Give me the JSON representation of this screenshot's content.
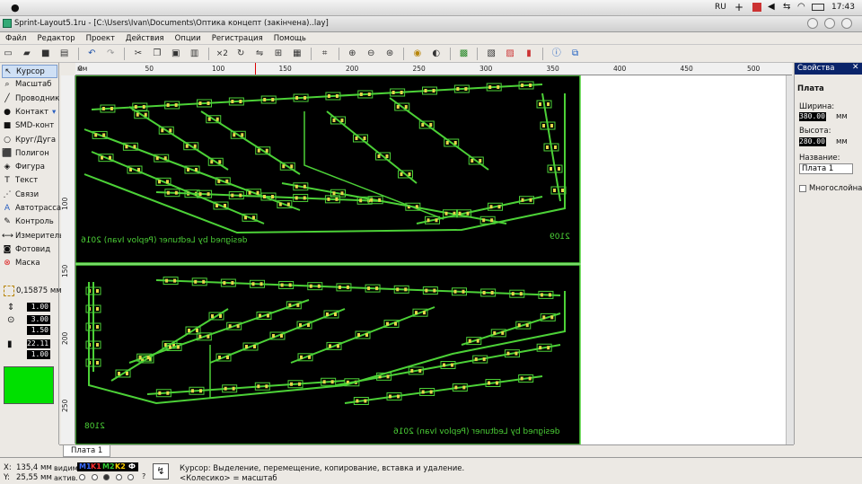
{
  "os_menubar": {
    "lang": "RU",
    "time": "17:43"
  },
  "window": {
    "title": "Sprint-Layout5.1ru - [C:\\Users\\Ivan\\Documents\\Оптика концепт (закінчена)..lay]"
  },
  "menu": [
    "Файл",
    "Редактор",
    "Проект",
    "Действия",
    "Опции",
    "Регистрация",
    "Помощь"
  ],
  "toolbar": {
    "zoom_label": "×2"
  },
  "tools": [
    {
      "name": "cursor",
      "label": "Курсор",
      "icon": "cursor-arrow-icon",
      "active": true
    },
    {
      "name": "zoom",
      "label": "Масштаб",
      "icon": "magnifier-icon"
    },
    {
      "name": "track",
      "label": "Проводник",
      "icon": "pen-icon"
    },
    {
      "name": "pad",
      "label": "Контакт",
      "icon": "pad-icon",
      "dropdown": true
    },
    {
      "name": "smd",
      "label": "SMD-конт",
      "icon": "smd-pad-icon"
    },
    {
      "name": "circle",
      "label": "Круг/Дуга",
      "icon": "circle-icon"
    },
    {
      "name": "polygon",
      "label": "Полигон",
      "icon": "polygon-icon"
    },
    {
      "name": "shape",
      "label": "Фигура",
      "icon": "shape-icon"
    },
    {
      "name": "text",
      "label": "Текст",
      "icon": "text-icon"
    },
    {
      "name": "connection",
      "label": "Связи",
      "icon": "connection-icon"
    },
    {
      "name": "autoroute",
      "label": "Автотрасса",
      "icon": "autoroute-icon"
    },
    {
      "name": "test",
      "label": "Контроль",
      "icon": "probe-icon"
    },
    {
      "name": "measure",
      "label": "Измеритель",
      "icon": "ruler-icon"
    },
    {
      "name": "photoview",
      "label": "Фотовид",
      "icon": "camera-icon"
    },
    {
      "name": "mask",
      "label": "Маска",
      "icon": "mask-icon"
    }
  ],
  "grid": {
    "value": "0,15875 мм"
  },
  "track_params": {
    "width": "1.00",
    "pad_outer": "3.00",
    "pad_inner": "1.50",
    "smd_w": "22.11",
    "smd_h": "1.00"
  },
  "colors": {
    "board_bg": "#000000",
    "copper": "#4cd137",
    "swatch": "#00e000",
    "pad_yellow": "#e6d84a"
  },
  "ruler": {
    "top_label": "мм",
    "top": [
      "0",
      "50",
      "100",
      "150",
      "200",
      "250",
      "300",
      "350",
      "400",
      "450",
      "500"
    ],
    "left": [
      "100",
      "150",
      "200",
      "250"
    ]
  },
  "board": {
    "top_credit": "designed by Ledtuner (Peplov Ivan) 2016",
    "top_code": "2109",
    "bottom_credit": "designed by Ledtuner (Peplov Ivan) 2016",
    "bottom_code": "2108"
  },
  "properties": {
    "header": "Свойства",
    "section": "Плата",
    "width_label": "Ширина:",
    "width_value": "380.00",
    "unit": "мм",
    "height_label": "Высота:",
    "height_value": "280.00",
    "name_label": "Название:",
    "name_value": "Плата 1",
    "multilayer_label": "Многослойная"
  },
  "tab": {
    "label": "Плата 1"
  },
  "status": {
    "x_label": "X:",
    "x_value": "135,4 мм",
    "y_label": "Y:",
    "y_value": "25,55 мм",
    "visible_label": "видим.",
    "active_label": "актив.",
    "layers": [
      "M1",
      "K1",
      "M2",
      "K2",
      "Ф"
    ],
    "hint_line1": "Курсор: Выделение, перемещение, копирование, вставка и удаление.",
    "hint_line2": "<Колесико> = масштаб"
  }
}
